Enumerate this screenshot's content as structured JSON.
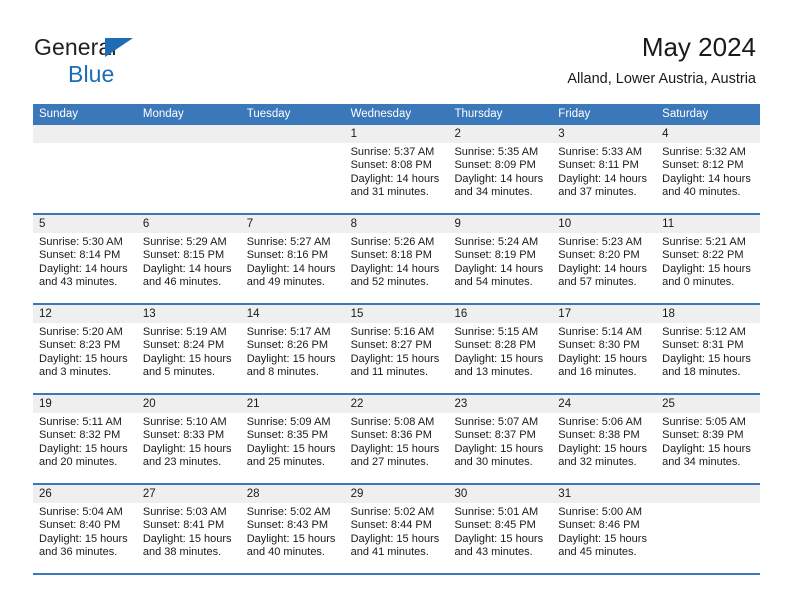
{
  "brand": {
    "line1": "General",
    "line2": "Blue",
    "accent_color": "#1d6cb5"
  },
  "header": {
    "title": "May 2024",
    "subtitle": "Alland, Lower Austria, Austria"
  },
  "theme": {
    "header_blue": "#3b78b9",
    "daynum_band": "#efefef",
    "text": "#1a1a1a"
  },
  "weekdays": [
    "Sunday",
    "Monday",
    "Tuesday",
    "Wednesday",
    "Thursday",
    "Friday",
    "Saturday"
  ],
  "weeks": [
    [
      {
        "day": "",
        "lines": [
          "",
          "",
          "",
          ""
        ]
      },
      {
        "day": "",
        "lines": [
          "",
          "",
          "",
          ""
        ]
      },
      {
        "day": "",
        "lines": [
          "",
          "",
          "",
          ""
        ]
      },
      {
        "day": "1",
        "lines": [
          "Sunrise: 5:37 AM",
          "Sunset: 8:08 PM",
          "Daylight: 14 hours",
          "and 31 minutes."
        ]
      },
      {
        "day": "2",
        "lines": [
          "Sunrise: 5:35 AM",
          "Sunset: 8:09 PM",
          "Daylight: 14 hours",
          "and 34 minutes."
        ]
      },
      {
        "day": "3",
        "lines": [
          "Sunrise: 5:33 AM",
          "Sunset: 8:11 PM",
          "Daylight: 14 hours",
          "and 37 minutes."
        ]
      },
      {
        "day": "4",
        "lines": [
          "Sunrise: 5:32 AM",
          "Sunset: 8:12 PM",
          "Daylight: 14 hours",
          "and 40 minutes."
        ]
      }
    ],
    [
      {
        "day": "5",
        "lines": [
          "Sunrise: 5:30 AM",
          "Sunset: 8:14 PM",
          "Daylight: 14 hours",
          "and 43 minutes."
        ]
      },
      {
        "day": "6",
        "lines": [
          "Sunrise: 5:29 AM",
          "Sunset: 8:15 PM",
          "Daylight: 14 hours",
          "and 46 minutes."
        ]
      },
      {
        "day": "7",
        "lines": [
          "Sunrise: 5:27 AM",
          "Sunset: 8:16 PM",
          "Daylight: 14 hours",
          "and 49 minutes."
        ]
      },
      {
        "day": "8",
        "lines": [
          "Sunrise: 5:26 AM",
          "Sunset: 8:18 PM",
          "Daylight: 14 hours",
          "and 52 minutes."
        ]
      },
      {
        "day": "9",
        "lines": [
          "Sunrise: 5:24 AM",
          "Sunset: 8:19 PM",
          "Daylight: 14 hours",
          "and 54 minutes."
        ]
      },
      {
        "day": "10",
        "lines": [
          "Sunrise: 5:23 AM",
          "Sunset: 8:20 PM",
          "Daylight: 14 hours",
          "and 57 minutes."
        ]
      },
      {
        "day": "11",
        "lines": [
          "Sunrise: 5:21 AM",
          "Sunset: 8:22 PM",
          "Daylight: 15 hours",
          "and 0 minutes."
        ]
      }
    ],
    [
      {
        "day": "12",
        "lines": [
          "Sunrise: 5:20 AM",
          "Sunset: 8:23 PM",
          "Daylight: 15 hours",
          "and 3 minutes."
        ]
      },
      {
        "day": "13",
        "lines": [
          "Sunrise: 5:19 AM",
          "Sunset: 8:24 PM",
          "Daylight: 15 hours",
          "and 5 minutes."
        ]
      },
      {
        "day": "14",
        "lines": [
          "Sunrise: 5:17 AM",
          "Sunset: 8:26 PM",
          "Daylight: 15 hours",
          "and 8 minutes."
        ]
      },
      {
        "day": "15",
        "lines": [
          "Sunrise: 5:16 AM",
          "Sunset: 8:27 PM",
          "Daylight: 15 hours",
          "and 11 minutes."
        ]
      },
      {
        "day": "16",
        "lines": [
          "Sunrise: 5:15 AM",
          "Sunset: 8:28 PM",
          "Daylight: 15 hours",
          "and 13 minutes."
        ]
      },
      {
        "day": "17",
        "lines": [
          "Sunrise: 5:14 AM",
          "Sunset: 8:30 PM",
          "Daylight: 15 hours",
          "and 16 minutes."
        ]
      },
      {
        "day": "18",
        "lines": [
          "Sunrise: 5:12 AM",
          "Sunset: 8:31 PM",
          "Daylight: 15 hours",
          "and 18 minutes."
        ]
      }
    ],
    [
      {
        "day": "19",
        "lines": [
          "Sunrise: 5:11 AM",
          "Sunset: 8:32 PM",
          "Daylight: 15 hours",
          "and 20 minutes."
        ]
      },
      {
        "day": "20",
        "lines": [
          "Sunrise: 5:10 AM",
          "Sunset: 8:33 PM",
          "Daylight: 15 hours",
          "and 23 minutes."
        ]
      },
      {
        "day": "21",
        "lines": [
          "Sunrise: 5:09 AM",
          "Sunset: 8:35 PM",
          "Daylight: 15 hours",
          "and 25 minutes."
        ]
      },
      {
        "day": "22",
        "lines": [
          "Sunrise: 5:08 AM",
          "Sunset: 8:36 PM",
          "Daylight: 15 hours",
          "and 27 minutes."
        ]
      },
      {
        "day": "23",
        "lines": [
          "Sunrise: 5:07 AM",
          "Sunset: 8:37 PM",
          "Daylight: 15 hours",
          "and 30 minutes."
        ]
      },
      {
        "day": "24",
        "lines": [
          "Sunrise: 5:06 AM",
          "Sunset: 8:38 PM",
          "Daylight: 15 hours",
          "and 32 minutes."
        ]
      },
      {
        "day": "25",
        "lines": [
          "Sunrise: 5:05 AM",
          "Sunset: 8:39 PM",
          "Daylight: 15 hours",
          "and 34 minutes."
        ]
      }
    ],
    [
      {
        "day": "26",
        "lines": [
          "Sunrise: 5:04 AM",
          "Sunset: 8:40 PM",
          "Daylight: 15 hours",
          "and 36 minutes."
        ]
      },
      {
        "day": "27",
        "lines": [
          "Sunrise: 5:03 AM",
          "Sunset: 8:41 PM",
          "Daylight: 15 hours",
          "and 38 minutes."
        ]
      },
      {
        "day": "28",
        "lines": [
          "Sunrise: 5:02 AM",
          "Sunset: 8:43 PM",
          "Daylight: 15 hours",
          "and 40 minutes."
        ]
      },
      {
        "day": "29",
        "lines": [
          "Sunrise: 5:02 AM",
          "Sunset: 8:44 PM",
          "Daylight: 15 hours",
          "and 41 minutes."
        ]
      },
      {
        "day": "30",
        "lines": [
          "Sunrise: 5:01 AM",
          "Sunset: 8:45 PM",
          "Daylight: 15 hours",
          "and 43 minutes."
        ]
      },
      {
        "day": "31",
        "lines": [
          "Sunrise: 5:00 AM",
          "Sunset: 8:46 PM",
          "Daylight: 15 hours",
          "and 45 minutes."
        ]
      },
      {
        "day": "",
        "lines": [
          "",
          "",
          "",
          ""
        ]
      }
    ]
  ]
}
